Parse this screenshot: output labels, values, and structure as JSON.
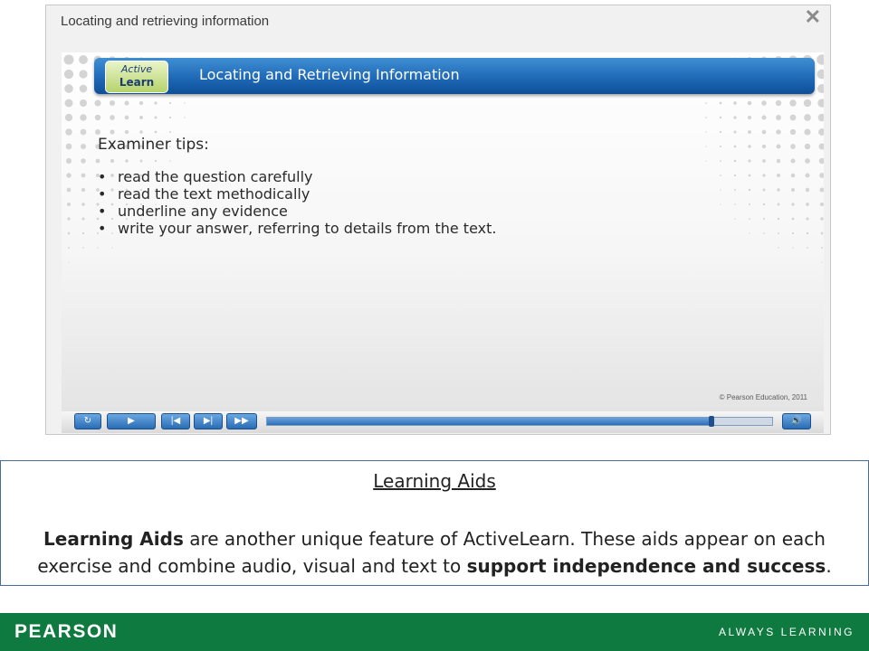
{
  "window": {
    "title": "Locating and retrieving information",
    "close_icon": "close-icon"
  },
  "slide": {
    "logo": {
      "line1": "Active",
      "line2": "Learn"
    },
    "header_title": "Locating and Retrieving Information",
    "tips_heading": "Examiner tips:",
    "tips": [
      "read the question carefully",
      "read the text methodically",
      "underline any evidence",
      "write your answer, referring to details from the text."
    ],
    "copyright": "© Pearson Education, 2011"
  },
  "player": {
    "buttons": [
      {
        "name": "replay-button",
        "icon": "replay-icon",
        "glyph": "↻"
      },
      {
        "name": "play-button",
        "icon": "play-icon",
        "glyph": "▶"
      },
      {
        "name": "previous-button",
        "icon": "skip-back-icon",
        "glyph": "|◀"
      },
      {
        "name": "next-button",
        "icon": "skip-forward-icon",
        "glyph": "▶|"
      },
      {
        "name": "fast-forward-button",
        "icon": "fast-forward-icon",
        "glyph": "▶▶"
      }
    ],
    "progress": 0.88,
    "volume_icon": "volume-icon",
    "volume_glyph": "🔊"
  },
  "caption": {
    "title": "Learning Aids",
    "body_bold_1": "Learning Aids",
    "body_1": " are another unique feature of ActiveLearn. These aids appear on each exercise and combine audio, visual and text to ",
    "body_bold_2": "support independence and success",
    "body_2": "."
  },
  "footer": {
    "brand": "PEARSON",
    "tagline": "ALWAYS LEARNING"
  },
  "colors": {
    "header_blue": "#1d66b4",
    "footer_green": "#0f7a3f",
    "logo_green": "#b6d36b"
  }
}
